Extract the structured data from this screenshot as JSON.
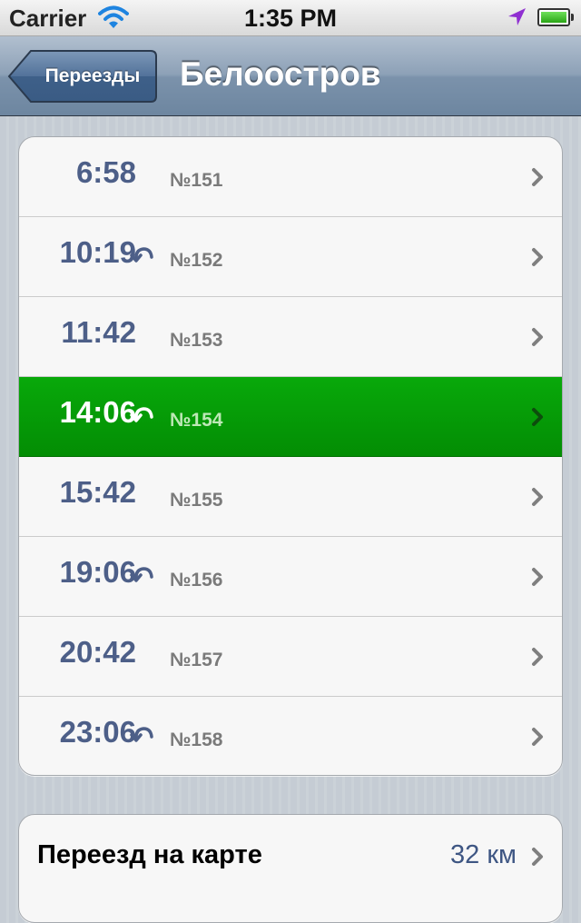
{
  "status_bar": {
    "carrier": "Carrier",
    "time": "1:35 PM",
    "icons": [
      "wifi-icon",
      "location-arrow-icon",
      "battery-icon"
    ]
  },
  "nav": {
    "back_label": "Переезды",
    "title": "Белоостров"
  },
  "schedule": [
    {
      "time": "6:58",
      "number": "№151",
      "return_icon": false,
      "selected": false
    },
    {
      "time": "10:19",
      "number": "№152",
      "return_icon": true,
      "selected": false
    },
    {
      "time": "11:42",
      "number": "№153",
      "return_icon": false,
      "selected": false
    },
    {
      "time": "14:06",
      "number": "№154",
      "return_icon": true,
      "selected": true
    },
    {
      "time": "15:42",
      "number": "№155",
      "return_icon": false,
      "selected": false
    },
    {
      "time": "19:06",
      "number": "№156",
      "return_icon": true,
      "selected": false
    },
    {
      "time": "20:42",
      "number": "№157",
      "return_icon": false,
      "selected": false
    },
    {
      "time": "23:06",
      "number": "№158",
      "return_icon": true,
      "selected": false
    }
  ],
  "map_row": {
    "label": "Переезд на карте",
    "value": "32 км"
  },
  "colors": {
    "selected_row": "#04a205",
    "time_text": "#4d5f88",
    "nav_bar": "#7b92ab"
  }
}
